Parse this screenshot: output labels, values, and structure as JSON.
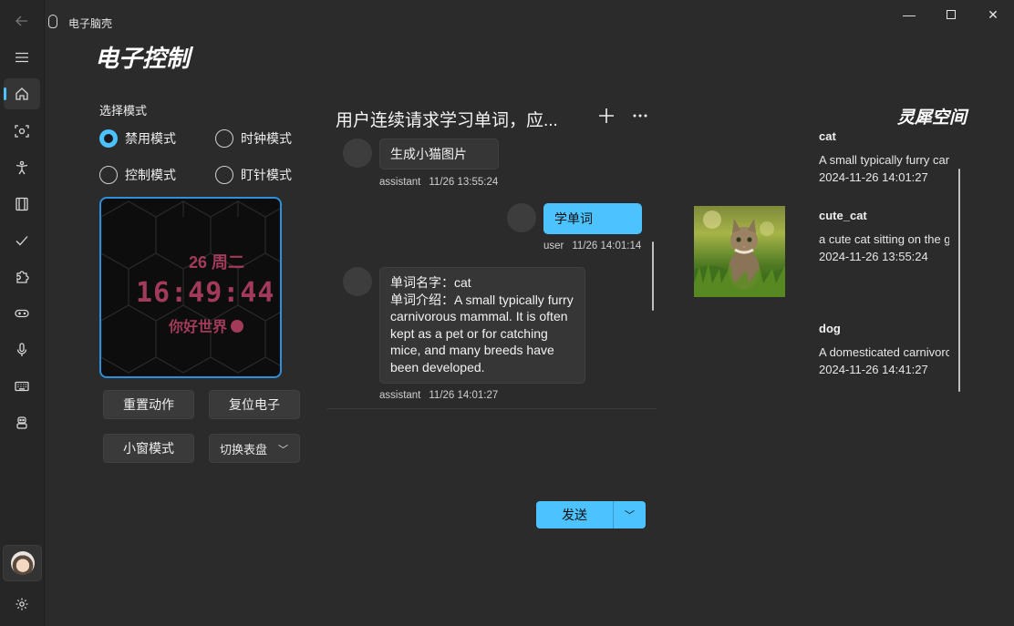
{
  "app": {
    "title": "电子脑壳"
  },
  "page": {
    "title": "电子控制"
  },
  "mode": {
    "label": "选择模式",
    "options": [
      {
        "label": "禁用模式",
        "selected": true
      },
      {
        "label": "时钟模式",
        "selected": false
      },
      {
        "label": "控制模式",
        "selected": false
      },
      {
        "label": "盯针模式",
        "selected": false
      }
    ]
  },
  "preview": {
    "date": "26 周二",
    "time": "16:49:44",
    "greeting": "你好世界",
    "text_color": "#a23a5a"
  },
  "buttons": {
    "reset_action": "重置动作",
    "reset_device": "复位电子",
    "small_window": "小窗模式",
    "switch_face": "切换表盘"
  },
  "chat": {
    "title": "用户连续请求学习单词，应...",
    "add_icon": "plus-icon",
    "more_icon": "more-icon",
    "messages": [
      {
        "role": "assistant",
        "text": "生成小猫图片",
        "time": "11/26 13:55:24"
      },
      {
        "role": "user",
        "text": "学单词",
        "time": "11/26 14:01:14"
      },
      {
        "role": "assistant",
        "lines": [
          "单词名字：cat",
          "单词介绍：A small typically furry",
          "carnivorous mammal. It is often",
          "kept as a pet or for catching",
          "mice, and many breeds have",
          "been developed."
        ],
        "time": "11/26 14:01:27"
      }
    ],
    "send_label": "发送"
  },
  "space": {
    "title": "灵犀空间",
    "items": [
      {
        "name": "cat",
        "desc": "A small typically furry carnivorous mammal",
        "date": "2024-11-26 14:01:27"
      },
      {
        "name": "cute_cat",
        "desc": "a cute cat sitting on the grass",
        "date": "2024-11-26 13:55:24"
      },
      {
        "name": "dog",
        "desc": "A domesticated carnivorous mammal",
        "date": "2024-11-26 14:41:27"
      }
    ]
  },
  "colors": {
    "accent": "#4cc2ff",
    "background": "#2b2b2b"
  }
}
